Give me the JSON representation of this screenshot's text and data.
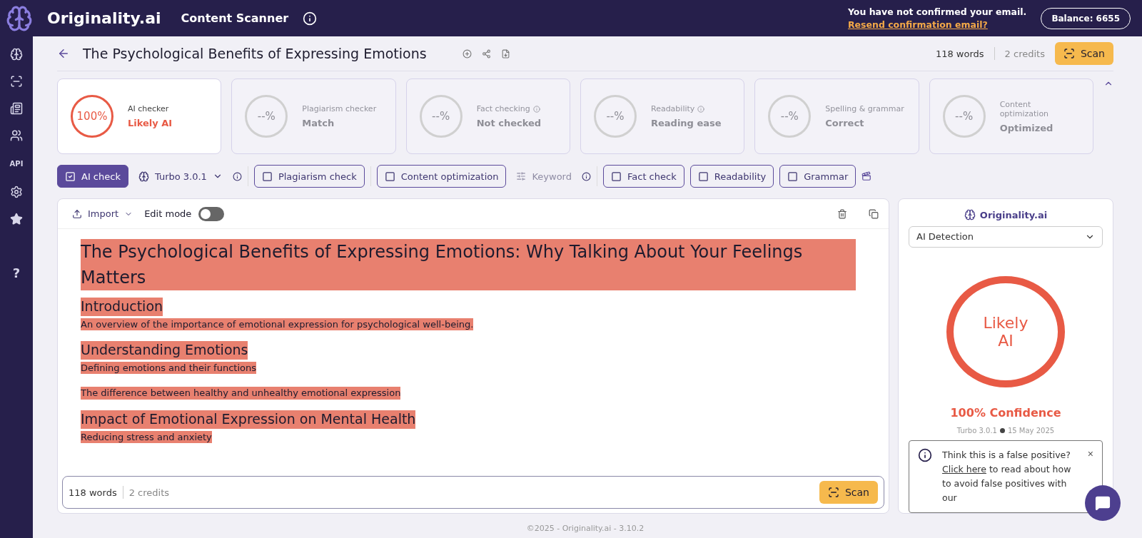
{
  "header": {
    "brand": "Originality.ai",
    "app_title": "Content Scanner",
    "notice": "You have not confirmed your email.",
    "notice_link": "Resend confirmation email?",
    "balance": "Balance: 6655"
  },
  "sidebar": {
    "items": [
      {
        "kind": "brain"
      },
      {
        "kind": "scanner"
      },
      {
        "kind": "news"
      },
      {
        "kind": "team"
      },
      {
        "kind": "text",
        "label": "API"
      },
      {
        "kind": "settings"
      },
      {
        "kind": "star"
      },
      {
        "kind": "text",
        "label": "?"
      }
    ]
  },
  "document": {
    "title": "The Psychological Benefits of Expressing Emotions",
    "words": "118 words",
    "credits": "2 credits",
    "scan": "Scan"
  },
  "score_cards": [
    {
      "value": "100%",
      "label": "AI checker",
      "result": "Likely AI",
      "active": true,
      "info": false
    },
    {
      "value": "--%",
      "label": "Plagiarism checker",
      "result": "Match",
      "active": false,
      "info": false
    },
    {
      "value": "--%",
      "label": "Fact checking",
      "result": "Not checked",
      "active": false,
      "info": true
    },
    {
      "value": "--%",
      "label": "Readability",
      "result": "Reading ease",
      "active": false,
      "info": true
    },
    {
      "value": "--%",
      "label": "Spelling & grammar",
      "result": "Correct",
      "active": false,
      "info": false
    },
    {
      "value": "--%",
      "label": "Content optimization",
      "result": "Optimized",
      "active": false,
      "info": false
    }
  ],
  "toolbar": [
    {
      "kind": "check",
      "label": "AI check",
      "checked": true
    },
    {
      "kind": "model",
      "label": "Turbo 3.0.1"
    },
    {
      "kind": "check",
      "label": "Plagiarism check",
      "checked": false
    },
    {
      "kind": "check",
      "label": "Content optimization",
      "checked": false
    },
    {
      "kind": "keyword",
      "label": "Keyword",
      "disabled": true
    },
    {
      "kind": "check",
      "label": "Fact check",
      "checked": false
    },
    {
      "kind": "check",
      "label": "Readability",
      "checked": false
    },
    {
      "kind": "check",
      "label": "Grammar",
      "checked": false
    }
  ],
  "editor": {
    "import": "Import",
    "edit_mode": {
      "label": "Edit mode",
      "on": false
    },
    "blocks": [
      {
        "kind": "h1",
        "text": "The Psychological Benefits of Expressing Emotions: Why Talking About Your Feelings Matters",
        "highlighted": true
      },
      {
        "kind": "h2",
        "text": "Introduction",
        "highlighted": true
      },
      {
        "kind": "p",
        "text": "An overview of the importance of emotional expression for psychological well-being.",
        "highlighted": true
      },
      {
        "kind": "h2",
        "text": "Understanding Emotions",
        "highlighted": true
      },
      {
        "kind": "p",
        "text": "Defining emotions and their functions",
        "highlighted": true
      },
      {
        "kind": "p",
        "text": "The difference between healthy and unhealthy emotional expression",
        "highlighted": true
      },
      {
        "kind": "h2",
        "text": "Impact of Emotional Expression on Mental Health",
        "highlighted": true
      },
      {
        "kind": "p",
        "text": "Reducing stress and anxiety",
        "highlighted": true
      }
    ],
    "words": "118 words",
    "credits": "2 credits",
    "scan": "Scan"
  },
  "result_panel": {
    "brand": "Originality.ai",
    "mode": "AI Detection",
    "verdict": "Likely AI",
    "confidence": "100% Confidence",
    "model": "Turbo 3.0.1",
    "date": "15 May 2025",
    "notice": {
      "text": "Think this is a false positive?",
      "link": "Click here",
      "rest": "to read about how to avoid false positives with our",
      "close": "×"
    }
  },
  "footer": "©2025 - Originality.ai - 3.10.2"
}
